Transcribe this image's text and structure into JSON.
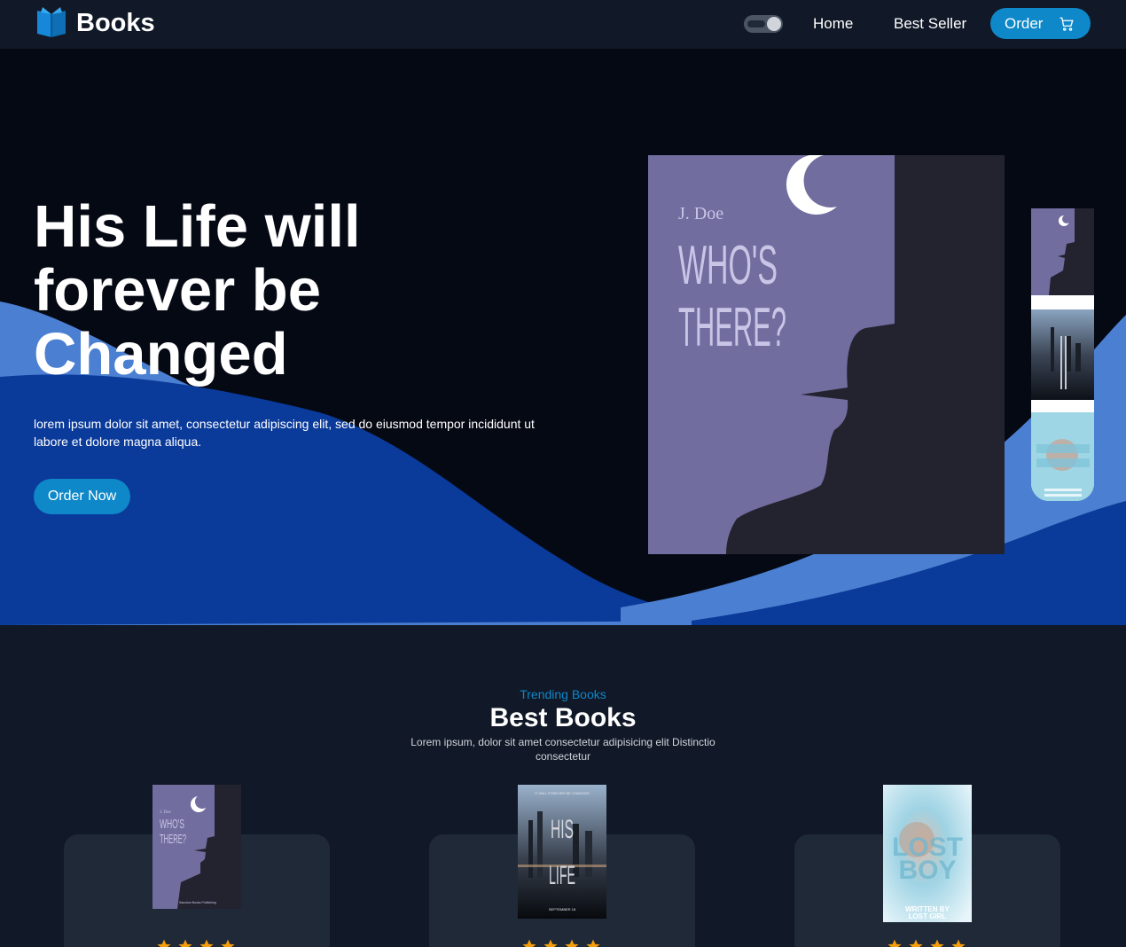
{
  "nav": {
    "brand": "Books",
    "links": [
      "Home",
      "Best Seller"
    ],
    "order_label": "Order"
  },
  "hero": {
    "title": "His Life will forever be Changed",
    "text": "lorem ipsum dolor sit amet, consectetur adipiscing elit, sed do eiusmod tempor incididunt ut labore et dolore magna aliqua.",
    "cta": "Order Now",
    "featured_cover": {
      "author": "J. Doe",
      "title_line1": "WHO'S",
      "title_line2": "THERE?"
    }
  },
  "trending": {
    "eyebrow": "Trending Books",
    "title": "Best Books",
    "description": "Lorem ipsum, dolor sit amet consectetur adipisicing elit Distinctio consectetur"
  },
  "books": [
    {
      "cover_author": "J. Doe",
      "cover_line1": "WHO'S",
      "cover_line2": "THERE?",
      "cover_publisher": "Sanctum Books Publishing",
      "rating": 4
    },
    {
      "cover_tagline": "IT WILL FOREVER BE CHANGED",
      "cover_line1": "HIS",
      "cover_line2": "LIFE",
      "cover_date": "SEPTEMBER 18",
      "rating": 4
    },
    {
      "cover_line1": "LOST",
      "cover_line2": "BOY",
      "cover_credit1": "WRITTEN BY",
      "cover_credit2": "LOST GIRL",
      "rating": 4
    }
  ],
  "colors": {
    "accent": "#0e88c8",
    "nav_bg": "#111827",
    "hero_bg": "#050914",
    "card_bg": "#1f2937",
    "wave_light": "#4b7fd1",
    "wave_dark": "#0a3a9a",
    "cover_purple": "#716d9f",
    "cover_shadow": "#23232f",
    "star": "#f59e0b"
  },
  "icons": [
    "open-book-logo-icon",
    "theme-toggle-icon",
    "cart-icon",
    "star-icon"
  ]
}
